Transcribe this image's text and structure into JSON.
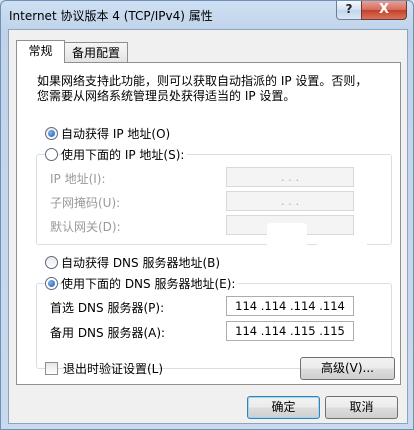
{
  "window": {
    "title": "Internet 协议版本 4 (TCP/IPv4) 属性",
    "help_label": "?",
    "close_label": "X"
  },
  "tabs": [
    {
      "label": "常规",
      "selected": true
    },
    {
      "label": "备用配置",
      "selected": false
    }
  ],
  "description": {
    "line1": "如果网络支持此功能，则可以获取自动指派的 IP 设置。否则，",
    "line2": "您需要从网络系统管理员处获得适当的 IP 设置。"
  },
  "ip_section": {
    "auto_label": "自动获得 IP 地址(O)",
    "auto_selected": true,
    "manual_label": "使用下面的 IP 地址(S):",
    "manual_selected": false,
    "fields": [
      {
        "label": "IP 地址(I):",
        "value": ". . ."
      },
      {
        "label": "子网掩码(U):",
        "value": ". . ."
      },
      {
        "label": "默认网关(D):",
        "value": ". . ."
      }
    ]
  },
  "dns_section": {
    "auto_label": "自动获得 DNS 服务器地址(B)",
    "auto_selected": false,
    "manual_label": "使用下面的 DNS 服务器地址(E):",
    "manual_selected": true,
    "fields": [
      {
        "label": "首选 DNS 服务器(P):",
        "value": "114 .114 .114 .114"
      },
      {
        "label": "备用 DNS 服务器(A):",
        "value": "114 .114 .115 .115"
      }
    ]
  },
  "validate_checkbox": {
    "label": "退出时验证设置(L)",
    "checked": false
  },
  "buttons": {
    "advanced": "高级(V)...",
    "ok": "确定",
    "cancel": "取消"
  },
  "colors": {
    "title_bar": "#c9daee",
    "close_button": "#c2412c",
    "radio_selected": "#1f57b3"
  }
}
